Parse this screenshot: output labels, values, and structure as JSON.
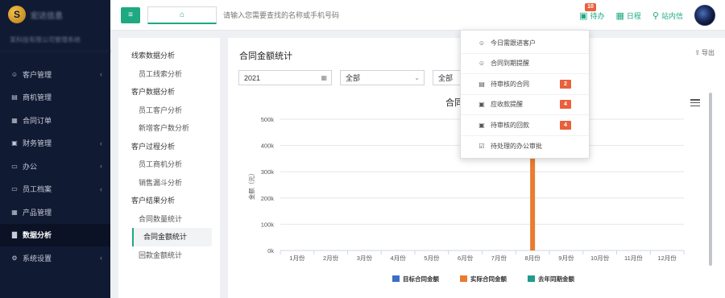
{
  "sidebar": {
    "logo_text": "宏达信息",
    "company_text": "某科技有限公司管理系统",
    "items": [
      {
        "label": "客户管理",
        "icon": "user-icon",
        "glyph": "☺",
        "arrow": "‹"
      },
      {
        "label": "商机管理",
        "icon": "briefcase-icon",
        "glyph": "▤",
        "arrow": ""
      },
      {
        "label": "合同订单",
        "icon": "document-icon",
        "glyph": "▦",
        "arrow": ""
      },
      {
        "label": "财务管理",
        "icon": "finance-icon",
        "glyph": "▣",
        "arrow": "‹"
      },
      {
        "label": "办公",
        "icon": "monitor-icon",
        "glyph": "▭",
        "arrow": "‹"
      },
      {
        "label": "员工档案",
        "icon": "desktop-icon",
        "glyph": "▭",
        "arrow": "‹"
      },
      {
        "label": "产品管理",
        "icon": "grid-icon",
        "glyph": "▦",
        "arrow": ""
      },
      {
        "label": "数据分析",
        "icon": "bar-chart-icon",
        "glyph": "▇",
        "arrow": ""
      },
      {
        "label": "系统设置",
        "icon": "gear-icon",
        "glyph": "⚙",
        "arrow": "‹"
      }
    ]
  },
  "topbar": {
    "menu_glyph": "≡",
    "home_glyph": "⌂",
    "search_placeholder": "请输入您需要查找的名称或手机号码",
    "todo_label": "待办",
    "todo_badge": "10",
    "schedule_label": "日程",
    "message_label": "站内信"
  },
  "subnav": {
    "groups": [
      {
        "title": "线索数据分析",
        "items": [
          "员工线索分析"
        ]
      },
      {
        "title": "客户数据分析",
        "items": [
          "员工客户分析",
          "新增客户数分析"
        ]
      },
      {
        "title": "客户过程分析",
        "items": [
          "员工商机分析",
          "销售漏斗分析"
        ]
      },
      {
        "title": "客户结果分析",
        "items": [
          "合同数量统计",
          "合同金额统计",
          "回款金额统计"
        ]
      }
    ]
  },
  "main": {
    "title": "合同金额统计",
    "export_label": "导出",
    "year_value": "2021",
    "select1_value": "全部",
    "select2_value": "全部"
  },
  "todo_dropdown": {
    "items": [
      {
        "label": "今日需跟进客户",
        "icon": "user-icon",
        "glyph": "☺",
        "badge": ""
      },
      {
        "label": "合同到期提醒",
        "icon": "user-icon",
        "glyph": "☺",
        "badge": ""
      },
      {
        "label": "待审核的合同",
        "icon": "contract-icon",
        "glyph": "▤",
        "badge": "2"
      },
      {
        "label": "应收款提醒",
        "icon": "money-icon",
        "glyph": "▣",
        "badge": "4"
      },
      {
        "label": "待审核的回款",
        "icon": "money-icon",
        "glyph": "▣",
        "badge": "4"
      },
      {
        "label": "待处理的办公审批",
        "icon": "check-icon",
        "glyph": "☑",
        "badge": ""
      }
    ]
  },
  "chart_data": {
    "type": "bar",
    "title": "合同金额统计",
    "ylabel": "金额（元）",
    "xlabel": "",
    "ylim": [
      0,
      500000
    ],
    "y_ticks": [
      "0k",
      "100k",
      "200k",
      "300k",
      "400k",
      "500k"
    ],
    "categories": [
      "1月份",
      "2月份",
      "3月份",
      "4月份",
      "5月份",
      "6月份",
      "7月份",
      "8月份",
      "9月份",
      "10月份",
      "11月份",
      "12月份"
    ],
    "series": [
      {
        "name": "目标合同金额",
        "color": "#3c6fc6",
        "values": [
          0,
          0,
          0,
          0,
          0,
          0,
          0,
          0,
          0,
          0,
          0,
          0
        ]
      },
      {
        "name": "实际合同金额",
        "color": "#e87c30",
        "values": [
          0,
          0,
          0,
          0,
          0,
          0,
          0,
          480000,
          0,
          0,
          0,
          0
        ]
      },
      {
        "name": "去年同期金额",
        "color": "#229a8c",
        "values": [
          0,
          0,
          0,
          0,
          0,
          0,
          0,
          0,
          0,
          0,
          0,
          0
        ]
      }
    ],
    "legend_position": "bottom",
    "grid": true
  }
}
